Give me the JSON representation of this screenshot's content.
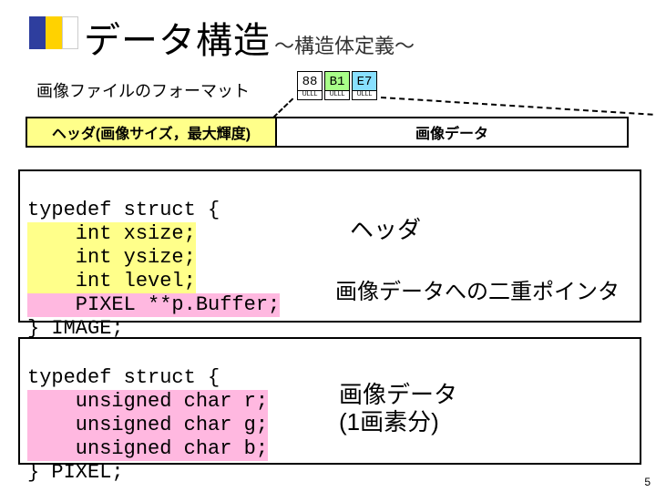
{
  "colors": {
    "accent1": "#2e3e9e",
    "accent2": "#ffd200",
    "accent3": "#ffffff",
    "hex_bg_88": "#ffffff",
    "hex_bg_b1": "#a8ff88",
    "hex_bg_e7": "#88e0ff"
  },
  "title": {
    "main": "データ構造",
    "sub": "～構造体定義～"
  },
  "format_label": "画像ファイルのフォーマット",
  "hex": {
    "c1": "88",
    "c2": "B1",
    "c3": "E7",
    "small": "ULLL"
  },
  "bar": {
    "header": "ヘッダ(画像サイズ，最大輝度)",
    "data": "画像データ"
  },
  "code1": {
    "l1": "typedef struct {",
    "l2a": "    int xsize;",
    "l3a": "    int ysize;",
    "l4a": "    int level;",
    "l5a": "    PIXEL **p.Buffer;",
    "l6": "} IMAGE;"
  },
  "labels": {
    "header": "ヘッダ",
    "ptr": "画像データへの二重ポインタ",
    "pixel_l1": "画像データ",
    "pixel_l2": "(1画素分)"
  },
  "code2": {
    "l1": "typedef struct {",
    "l2a": "    unsigned char r;",
    "l3a": "    unsigned char g;",
    "l4a": "    unsigned char b;",
    "l5": "} PIXEL;"
  },
  "page": "5"
}
